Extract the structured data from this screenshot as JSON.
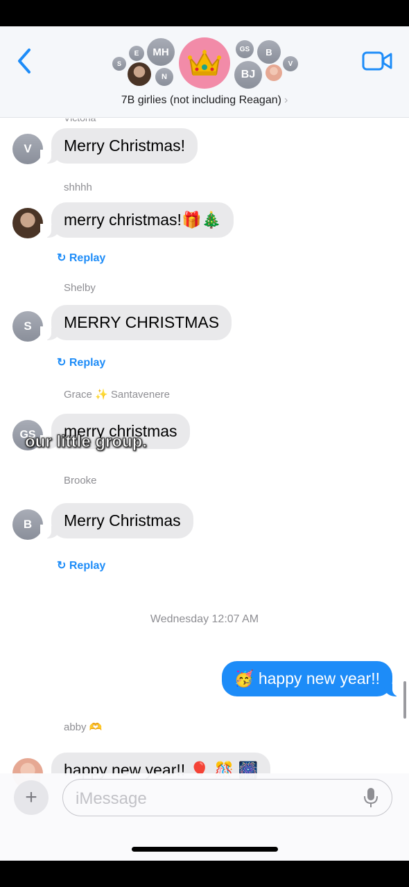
{
  "header": {
    "group_name": "7B girlies (not including Reagan)",
    "chevron": "›",
    "member_initials": [
      "S",
      "E",
      "MH",
      "N",
      "GS",
      "B",
      "BJ",
      "V"
    ],
    "group_icon": "crown-icon",
    "back_icon": "chevron-left-icon",
    "video_icon": "video-camera-icon"
  },
  "messages": {
    "clipped_name": "Victoria",
    "m1": {
      "avatar": "V",
      "text": "Merry Christmas!"
    },
    "m2": {
      "sender": "shhhh",
      "text": "merry christmas!🎁🎄",
      "replay": "Replay"
    },
    "m3": {
      "sender": "Shelby",
      "avatar": "S",
      "text": "MERRY CHRISTMAS",
      "replay": "Replay"
    },
    "m4": {
      "sender": "Grace ✨ Santavenere",
      "avatar": "GS",
      "text": "merry christmas"
    },
    "m5": {
      "sender": "Brooke",
      "avatar": "B",
      "text": "Merry Christmas",
      "replay": "Replay"
    },
    "timestamp": "Wednesday 12:07 AM",
    "m6": {
      "text": "🥳 happy new year!!"
    },
    "m7": {
      "sender": "abby 🫶",
      "text": "happy new year!! 🎈 🎊 🎆"
    }
  },
  "overlay_caption": "our little group.",
  "composer": {
    "placeholder": "iMessage",
    "plus_label": "+"
  },
  "colors": {
    "accent": "#1d8cf8",
    "bubble_gray": "#e9e9eb",
    "crown_bg": "#f28ba8"
  }
}
